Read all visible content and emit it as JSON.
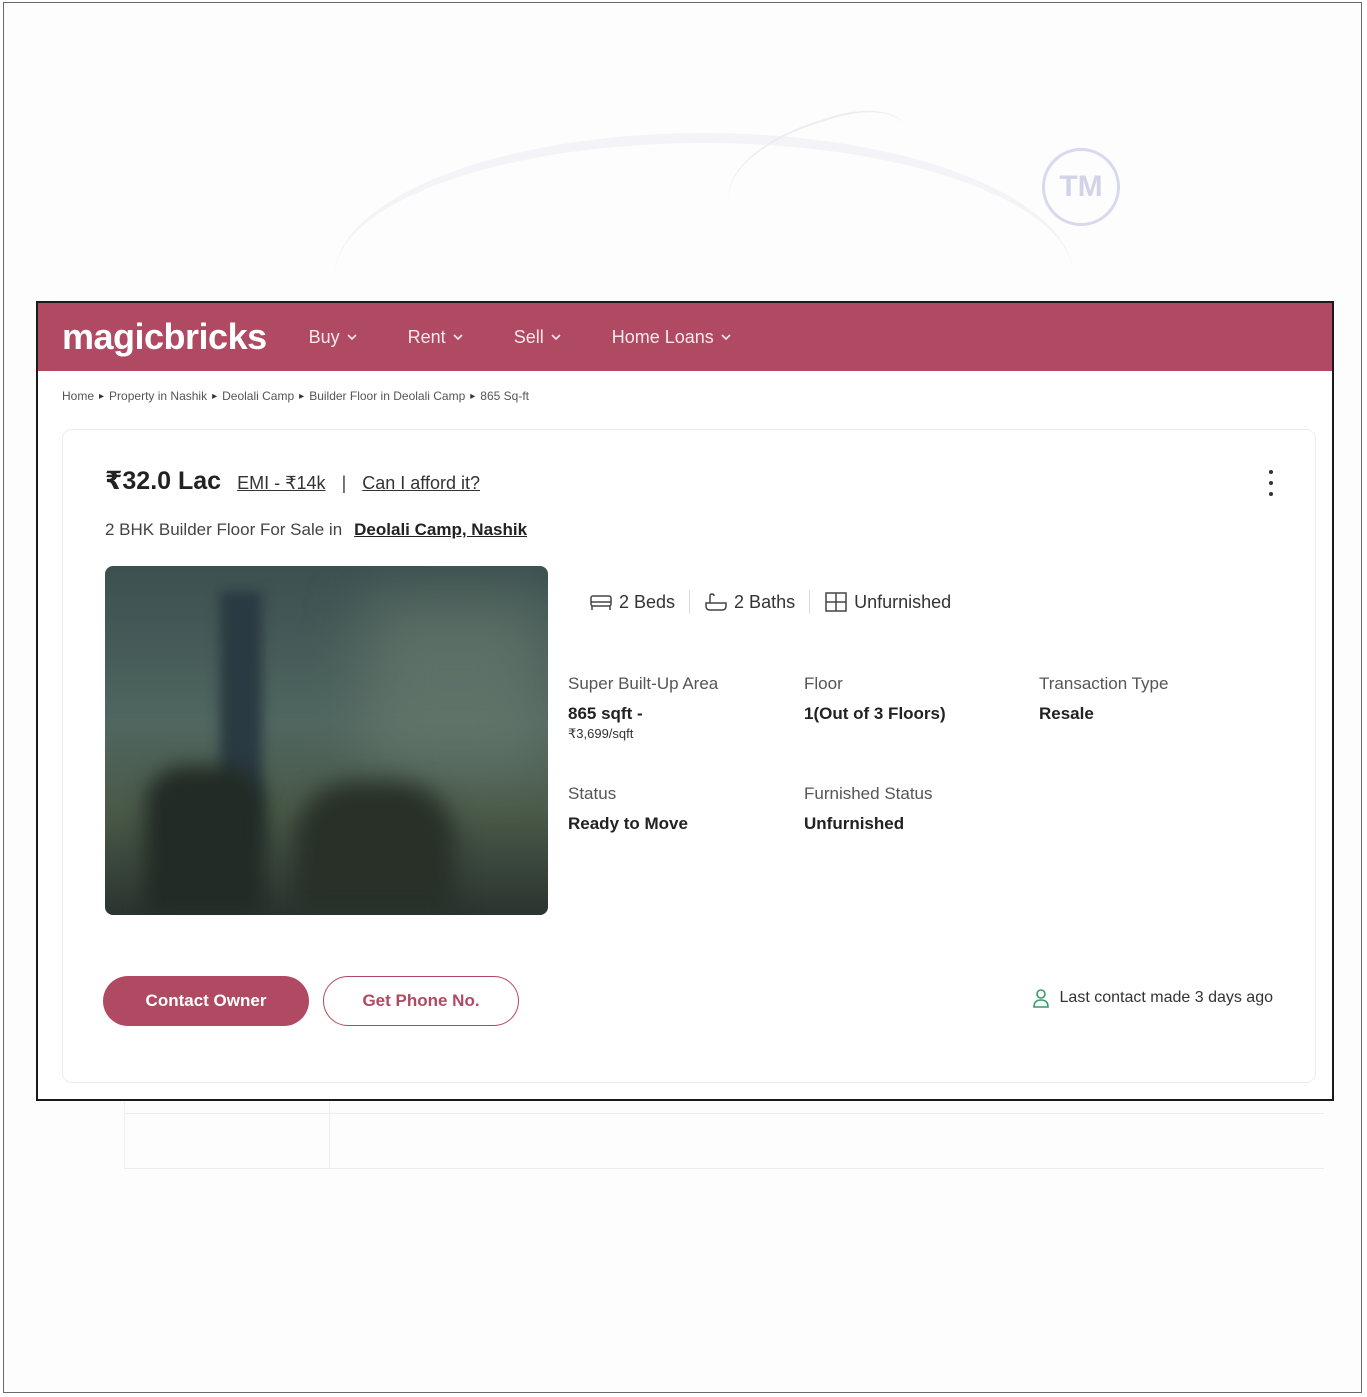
{
  "background": {
    "ghost_seal": "TM"
  },
  "nav": {
    "logo": "magicbricks",
    "items": [
      "Buy",
      "Rent",
      "Sell",
      "Home Loans"
    ]
  },
  "breadcrumb": [
    "Home",
    "Property in Nashik",
    "Deolali Camp",
    "Builder Floor in Deolali Camp",
    "865 Sq-ft"
  ],
  "listing": {
    "price": "₹32.0 Lac",
    "emi": "EMI - ₹14k",
    "separator": "|",
    "afford": "Can I afford it?",
    "subtitle": "2 BHK Builder Floor For Sale in",
    "location": "Deolali Camp, Nashik",
    "amenities": {
      "beds": "2 Beds",
      "baths": "2 Baths",
      "furnishing": "Unfurnished"
    },
    "details": {
      "area_label": "Super Built-Up Area",
      "area_value": "865 sqft -",
      "area_rate": "₹3,699/sqft",
      "floor_label": "Floor",
      "floor_value": "1(Out of 3 Floors)",
      "transaction_label": "Transaction Type",
      "transaction_value": "Resale",
      "status_label": "Status",
      "status_value": "Ready to Move",
      "furnished_label": "Furnished Status",
      "furnished_value": "Unfurnished"
    },
    "buttons": {
      "contact": "Contact Owner",
      "phone": "Get Phone No."
    },
    "last_contact": "Last contact made 3 days ago"
  },
  "colors": {
    "brand": "#b04a62",
    "text": "#222222"
  }
}
